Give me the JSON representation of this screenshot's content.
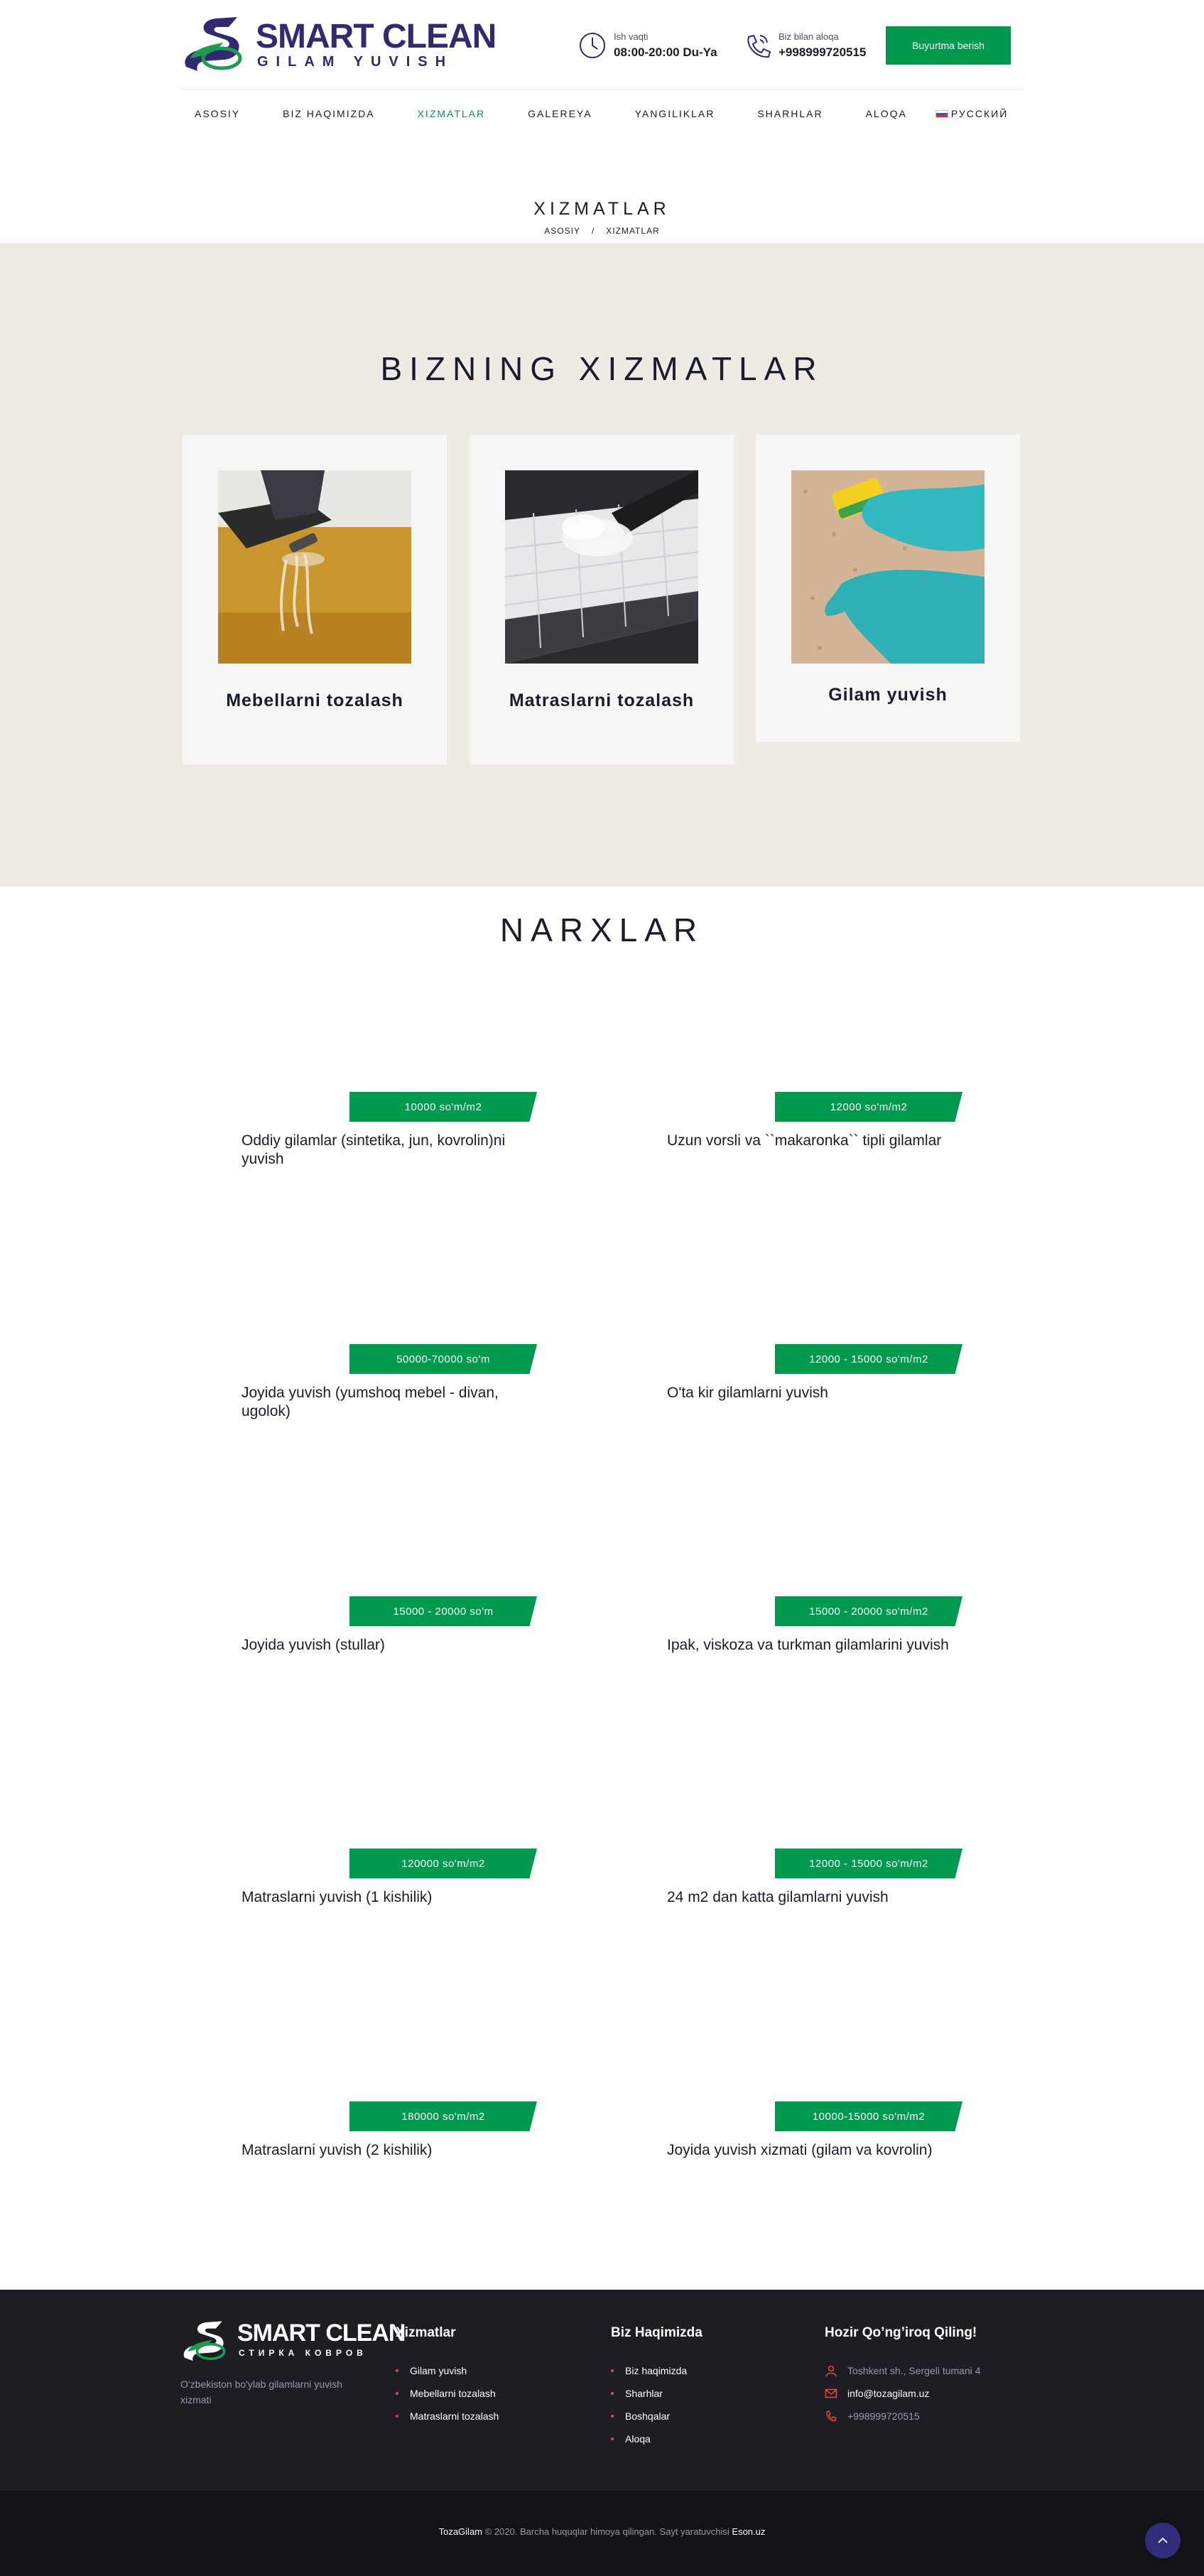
{
  "header": {
    "logo_title": "SMART CLEAN",
    "logo_subtitle": "GILAM YUVISH",
    "hours_label": "Ish vaqti",
    "hours_value": "08:00-20:00 Du-Ya",
    "phone_label": "Biz bilan aloqa",
    "phone_value": "+998999720515",
    "order_button": "Buyurtma berish"
  },
  "nav": {
    "items": [
      "ASOSIY",
      "BIZ HAQIMIZDA",
      "XIZMATLAR",
      "GALEREYA",
      "YANGILIKLAR",
      "SHARHLAR",
      "ALOQA"
    ],
    "lang": "РУССКИЙ",
    "active": "XIZMATLAR"
  },
  "page": {
    "title": "XIZMATLAR",
    "breadcrumb_home": "ASOSIY",
    "breadcrumb_sep": "/",
    "breadcrumb_current": "XIZMATLAR"
  },
  "services": {
    "title": "BIZNING XIZMATLAR",
    "cards": [
      {
        "caption": "Mebellarni tozalash"
      },
      {
        "caption": "Matraslarni tozalash"
      },
      {
        "caption": "Gilam yuvish"
      }
    ]
  },
  "prices": {
    "title": "NARXLAR",
    "items": [
      {
        "price": "10000 so'm/m2",
        "name": "Oddiy gilamlar (sintetika, jun, kovrolin)ni yuvish"
      },
      {
        "price": "12000 so'm/m2",
        "name": "Uzun vorsli va ``makaronka`` tipli gilamlar"
      },
      {
        "price": "50000-70000 so'm",
        "name": "Joyida yuvish (yumshoq mebel - divan, ugolok)"
      },
      {
        "price": "12000 - 15000 so'm/m2",
        "name": "O'ta kir gilamlarni yuvish"
      },
      {
        "price": "15000 - 20000 so'm",
        "name": "Joyida yuvish (stullar)"
      },
      {
        "price": "15000 - 20000 so'm/m2",
        "name": "Ipak, viskoza va turkman gilamlarini yuvish"
      },
      {
        "price": "120000 so'm/m2",
        "name": "Matraslarni yuvish (1 kishilik)"
      },
      {
        "price": "12000 - 15000 so'm/m2",
        "name": "24 m2 dan katta gilamlarni yuvish"
      },
      {
        "price": "180000 so'm/m2",
        "name": "Matraslarni yuvish (2 kishilik)"
      },
      {
        "price": "10000-15000 so'm/m2",
        "name": "Joyida yuvish xizmati (gilam va kovrolin)"
      }
    ]
  },
  "footer": {
    "logo_title": "SMART CLEAN",
    "logo_subtitle": "СТИРКА КОВРОВ",
    "description": "O'zbekiston bo'ylab gilamlarni yuvish xizmati",
    "col1_title": "Xizmatlar",
    "col1_items": [
      "Gilam yuvish",
      "Mebellarni tozalash",
      "Matraslarni tozalash"
    ],
    "col2_title": "Biz Haqimizda",
    "col2_items": [
      "Biz haqimizda",
      "Sharhlar",
      "Boshqalar",
      "Aloqa"
    ],
    "col3_title": "Hozir Qo’ng’iroq Qiling!",
    "address": "Toshkent sh., Sergeli tumani 4",
    "email": "info@tozagilam.uz",
    "phone": "+998999720515",
    "copyright_brand": "TozaGilam",
    "copyright_text": " © 2020. Barcha huquqlar himoya qilingan. Sayt yaratuvchisi ",
    "copyright_dev": "Eson.uz"
  },
  "colors": {
    "accent": "#009a4e",
    "brand": "#302a70",
    "band": "#eeebe5",
    "footer": "#1d1d24"
  }
}
